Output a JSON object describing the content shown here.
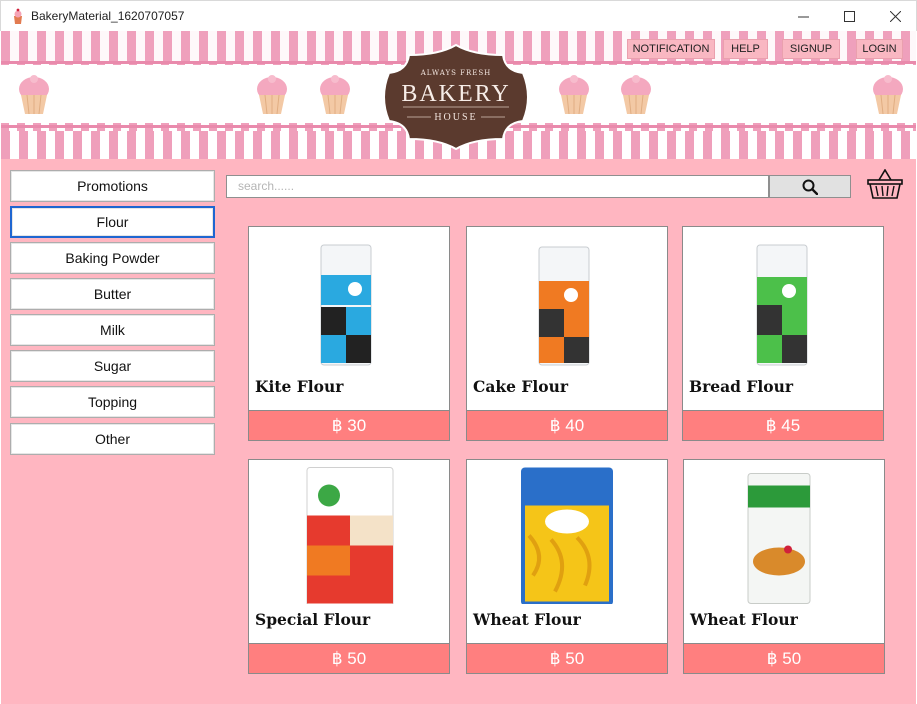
{
  "window": {
    "title": "BakeryMaterial_1620707057",
    "minimize": "—",
    "maximize": "☐",
    "close": "✕"
  },
  "header": {
    "logo": {
      "top_text": "ALWAYS FRESH",
      "main_text": "BAKERY",
      "bottom_text": "HOUSE"
    },
    "nav": [
      "NOTIFICATION",
      "HELP",
      "SIGNUP",
      "LOGIN"
    ]
  },
  "sidebar": {
    "categories": [
      "Promotions",
      "Flour",
      "Baking Powder",
      "Butter",
      "Milk",
      "Sugar",
      "Topping",
      "Other"
    ],
    "selected": "Flour"
  },
  "search": {
    "placeholder": "search......"
  },
  "products": [
    {
      "name": "Kite Flour",
      "price": "฿ 30",
      "image": "kite-flour-bag",
      "accent": "#2aa9e0"
    },
    {
      "name": "Cake Flour",
      "price": "฿ 40",
      "image": "cake-flour-bag",
      "accent": "#f07a22"
    },
    {
      "name": "Bread Flour",
      "price": "฿ 45",
      "image": "bread-flour-bag",
      "accent": "#4cc04a"
    },
    {
      "name": "Special Flour",
      "price": "฿ 50",
      "image": "red-lotus-flour-bag",
      "accent": "#e63a2e"
    },
    {
      "name": "Wheat Flour",
      "price": "฿ 50",
      "image": "555-wheat-flour-bag",
      "accent": "#f5c518"
    },
    {
      "name": "Wheat Flour",
      "price": "฿ 50",
      "image": "pi-wheat-flour-bag",
      "accent": "#2c9a3a"
    }
  ],
  "colors": {
    "background": "#ffb6c1",
    "price_bar": "#ff7f7f",
    "nav_button": "#f9b7c2",
    "logo_brown": "#5b3a2e"
  }
}
